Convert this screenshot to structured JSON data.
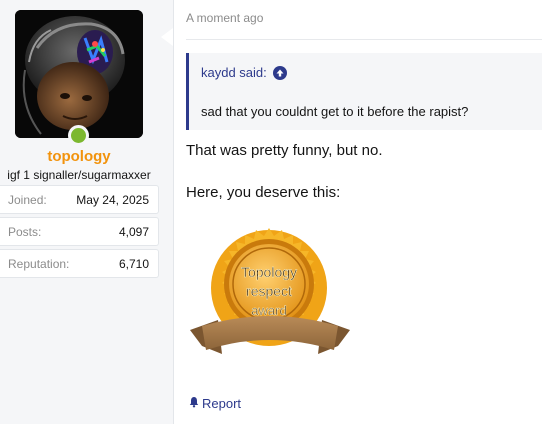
{
  "user": {
    "name": "topology",
    "title": "igf 1 signaller/sugarmaxxer",
    "online": true,
    "stats": [
      {
        "key": "Joined:",
        "value": "May 24, 2025"
      },
      {
        "key": "Posts:",
        "value": "4,097"
      },
      {
        "key": "Reputation:",
        "value": "6,710"
      }
    ]
  },
  "post": {
    "timestamp": "A moment ago",
    "quote": {
      "author": "kaydd said:",
      "text": "sad that you couldnt get to it before the rapist?"
    },
    "paragraph1": "That was pretty funny, but no.",
    "paragraph2": "Here, you deserve this:",
    "award": {
      "line1": "Topology",
      "line2": "respect",
      "line3": "award"
    },
    "report_label": "Report"
  },
  "colors": {
    "username": "#f2930d",
    "link": "#2d3a8c",
    "online": "#7cb82f",
    "medal_gold": "#f0a417",
    "ribbon": "#a57a4a"
  },
  "icons": {
    "quote_jump": "arrow-up-circle-icon",
    "report": "bell-icon"
  }
}
